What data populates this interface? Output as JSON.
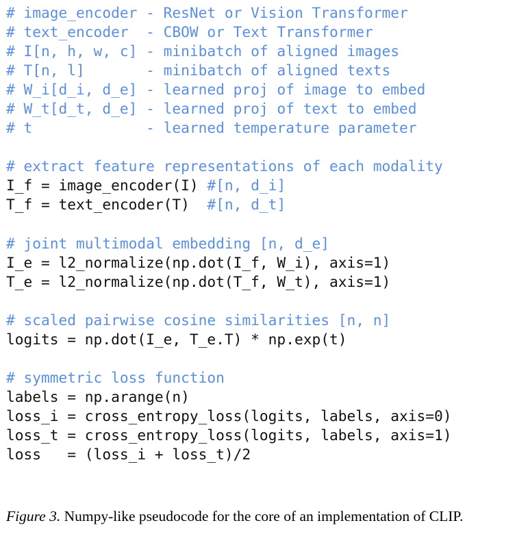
{
  "figure": {
    "kind": "pseudocode-listing",
    "colors": {
      "background": "#ffffff",
      "code_text": "#111111",
      "comment_text": "#5b8fe0",
      "caption_text": "#000000"
    },
    "caption": {
      "label": "Figure 3.",
      "text": " Numpy-like pseudocode for the core of an implementation of CLIP."
    },
    "code": {
      "language": "python-pseudocode",
      "lines": [
        {
          "id": "line-1",
          "type": "comment",
          "text": "# image_encoder - ResNet or Vision Transformer"
        },
        {
          "id": "line-2",
          "type": "comment",
          "text": "# text_encoder  - CBOW or Text Transformer"
        },
        {
          "id": "line-3",
          "type": "comment",
          "text": "# I[n, h, w, c] - minibatch of aligned images"
        },
        {
          "id": "line-4",
          "type": "comment",
          "text": "# T[n, l]       - minibatch of aligned texts"
        },
        {
          "id": "line-5",
          "type": "comment",
          "text": "# W_i[d_i, d_e] - learned proj of image to embed"
        },
        {
          "id": "line-6",
          "type": "comment",
          "text": "# W_t[d_t, d_e] - learned proj of text to embed"
        },
        {
          "id": "line-7",
          "type": "comment",
          "text": "# t             - learned temperature parameter"
        },
        {
          "id": "line-8",
          "type": "blank",
          "text": ""
        },
        {
          "id": "line-9",
          "type": "comment",
          "text": "# extract feature representations of each modality"
        },
        {
          "id": "line-10",
          "type": "mixed",
          "code": "I_f = image_encoder(I) ",
          "comment": "#[n, d_i]"
        },
        {
          "id": "line-11",
          "type": "mixed",
          "code": "T_f = text_encoder(T)  ",
          "comment": "#[n, d_t]"
        },
        {
          "id": "line-12",
          "type": "blank",
          "text": ""
        },
        {
          "id": "line-13",
          "type": "comment",
          "text": "# joint multimodal embedding [n, d_e]"
        },
        {
          "id": "line-14",
          "type": "code",
          "text": "I_e = l2_normalize(np.dot(I_f, W_i), axis=1)"
        },
        {
          "id": "line-15",
          "type": "code",
          "text": "T_e = l2_normalize(np.dot(T_f, W_t), axis=1)"
        },
        {
          "id": "line-16",
          "type": "blank",
          "text": ""
        },
        {
          "id": "line-17",
          "type": "comment",
          "text": "# scaled pairwise cosine similarities [n, n]"
        },
        {
          "id": "line-18",
          "type": "code",
          "text": "logits = np.dot(I_e, T_e.T) * np.exp(t)"
        },
        {
          "id": "line-19",
          "type": "blank",
          "text": ""
        },
        {
          "id": "line-20",
          "type": "comment",
          "text": "# symmetric loss function"
        },
        {
          "id": "line-21",
          "type": "code",
          "text": "labels = np.arange(n)"
        },
        {
          "id": "line-22",
          "type": "code",
          "text": "loss_i = cross_entropy_loss(logits, labels, axis=0)"
        },
        {
          "id": "line-23",
          "type": "code",
          "text": "loss_t = cross_entropy_loss(logits, labels, axis=1)"
        },
        {
          "id": "line-24",
          "type": "code",
          "text": "loss   = (loss_i + loss_t)/2"
        }
      ]
    }
  }
}
